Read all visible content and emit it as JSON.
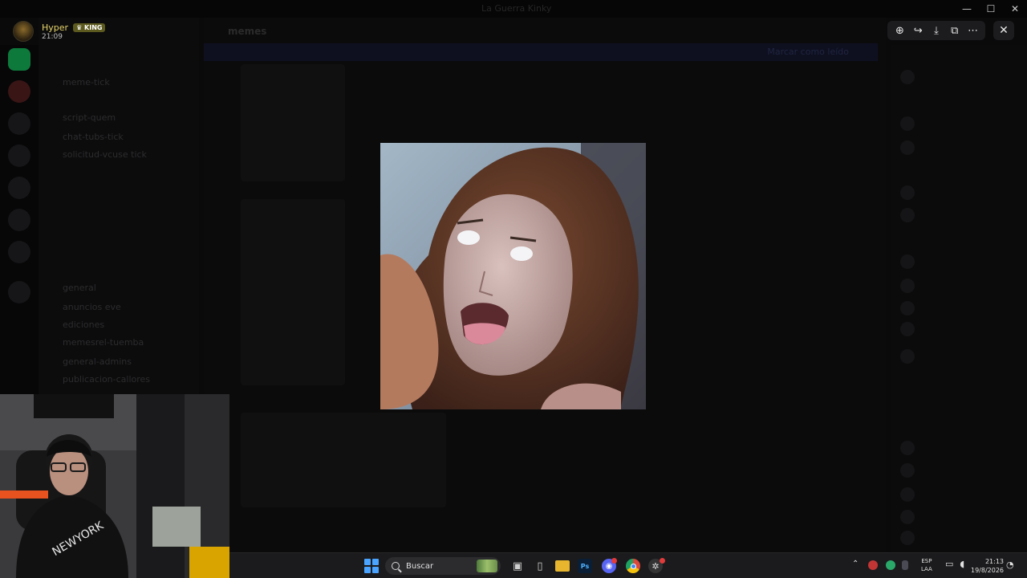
{
  "window": {
    "title": "La Guerra Kinky",
    "controls": [
      "—",
      "☐",
      "✕"
    ]
  },
  "profile": {
    "name": "Hyper",
    "badge": "KING",
    "time": "21:09"
  },
  "viewer": {
    "toolbar": [
      {
        "name": "zoom-in-icon",
        "glyph": "⊕"
      },
      {
        "name": "forward-icon",
        "glyph": "↪"
      },
      {
        "name": "download-icon",
        "glyph": "⤓"
      },
      {
        "name": "open-external-icon",
        "glyph": "⧉"
      },
      {
        "name": "more-options-icon",
        "glyph": "⋯"
      }
    ],
    "close_glyph": "✕"
  },
  "background": {
    "chat_header": "memes",
    "channels": [
      "meme-tick",
      "",
      "script-quem",
      "chat-tubs-tick",
      "solicitud-vcuse tick",
      "",
      "",
      "",
      "",
      "general",
      "anuncios eve",
      "ediciones",
      "memesrel-tuemba",
      "general-admins",
      "publicacion-callores"
    ],
    "banner_link": "Marcar como leído"
  },
  "taskbar": {
    "search_placeholder": "Buscar",
    "apps": [
      {
        "name": "task-view-icon",
        "glyph": "▣",
        "color": "#cfcfcf",
        "bg": "transparent"
      },
      {
        "name": "device-icon",
        "glyph": "▯",
        "color": "#cfcfcf",
        "bg": "transparent"
      },
      {
        "name": "file-explorer-icon",
        "glyph": "",
        "color": "#f2c744",
        "bg": "#e7b62e"
      },
      {
        "name": "photoshop-icon",
        "glyph": "Ps",
        "color": "#4fb1ff",
        "bg": "#0a1f36"
      },
      {
        "name": "discord-icon",
        "glyph": "◉",
        "color": "#ffffff",
        "bg": "#5865f2"
      },
      {
        "name": "chrome-icon",
        "glyph": "◎",
        "color": "#ffffff",
        "bg": "#d84a3b"
      },
      {
        "name": "app-icon",
        "glyph": "✲",
        "color": "#dddddd",
        "bg": "#333333"
      }
    ],
    "language_line1": "ESP",
    "language_line2": "LAA",
    "time": "21:13",
    "date": "19/8/2026"
  }
}
